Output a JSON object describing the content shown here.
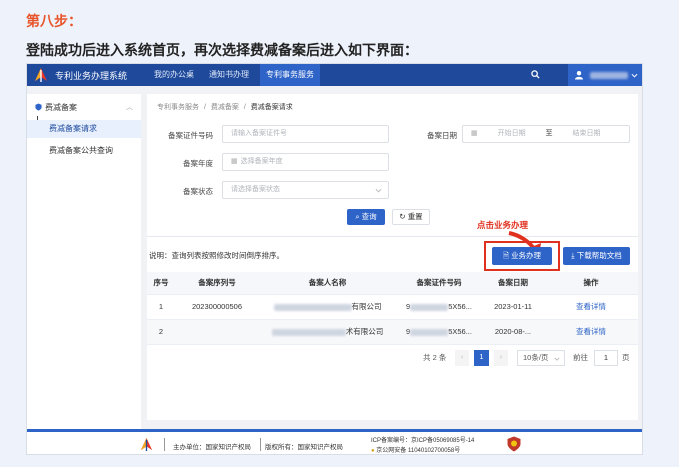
{
  "doc": {
    "step_title": "第八步：",
    "description": "登陆成功后进入系统首页，再次选择费减备案后进入如下界面："
  },
  "app": {
    "title": "专利业务办理系统",
    "nav": [
      "我的办公桌",
      "通知书办理",
      "专利事务服务"
    ],
    "active_nav": "专利事务服务"
  },
  "sidebar": {
    "group": "费减备案",
    "items": [
      "费减备案请求",
      "费减备案公共查询"
    ],
    "active_item": "费减备案请求"
  },
  "breadcrumb": {
    "items": [
      "专利事务服务",
      "费减备案",
      "费减备案请求"
    ],
    "separator": "/"
  },
  "form": {
    "cert_no_label": "备案证件号码",
    "cert_no_placeholder": "请输入备案证件号",
    "date_label": "备案日期",
    "date_start_placeholder": "开始日期",
    "date_to": "至",
    "date_end_placeholder": "结束日期",
    "year_label": "备案年度",
    "year_placeholder": "选择备案年度",
    "status_label": "备案状态",
    "status_placeholder": "请选择备案状态",
    "query_button": "查询",
    "reset_button": "重置"
  },
  "list": {
    "note": "说明：查询列表按照修改时间倒序排序。",
    "handle_button": "业务办理",
    "download_button": "下载帮助文档",
    "callout": "点击业务办理",
    "columns": [
      "序号",
      "备案序列号",
      "备案人名称",
      "备案证件号码",
      "备案日期",
      "操作"
    ],
    "rows": [
      {
        "index": "1",
        "serial": "202300000506",
        "name_suffix": "有限公司",
        "cert_prefix": "9",
        "cert_suffix": "5X56...",
        "date": "2023-01-11",
        "action": "查看详情"
      },
      {
        "index": "2",
        "serial": "",
        "name_suffix": "术有限公司",
        "cert_prefix": "9",
        "cert_suffix": "5X56...",
        "date": "2020-08-...",
        "action": "查看详情"
      }
    ]
  },
  "pagination": {
    "total": "共 2 条",
    "prev": "‹",
    "current_page": "1",
    "next": "›",
    "page_size": "10条/页",
    "goto_label": "前往",
    "goto_value": "1",
    "page_unit": "页"
  },
  "footer": {
    "sponsor": "主办单位：国家知识产权局",
    "copyright": "版权所有：国家知识产权局",
    "icp": "ICP备案编号：京ICP备05069085号-14",
    "police": "京公网安备 11040102700058号"
  },
  "colors": {
    "brand": "#1f4a9c",
    "accent": "#2e63c8",
    "step": "#e8552b",
    "callout": "#e0301e"
  },
  "icons": [
    "logo-icon",
    "search-icon",
    "user-icon",
    "chevron-down-icon",
    "shield-icon",
    "calendar-icon",
    "file-icon",
    "download-icon",
    "police-badge-icon"
  ]
}
